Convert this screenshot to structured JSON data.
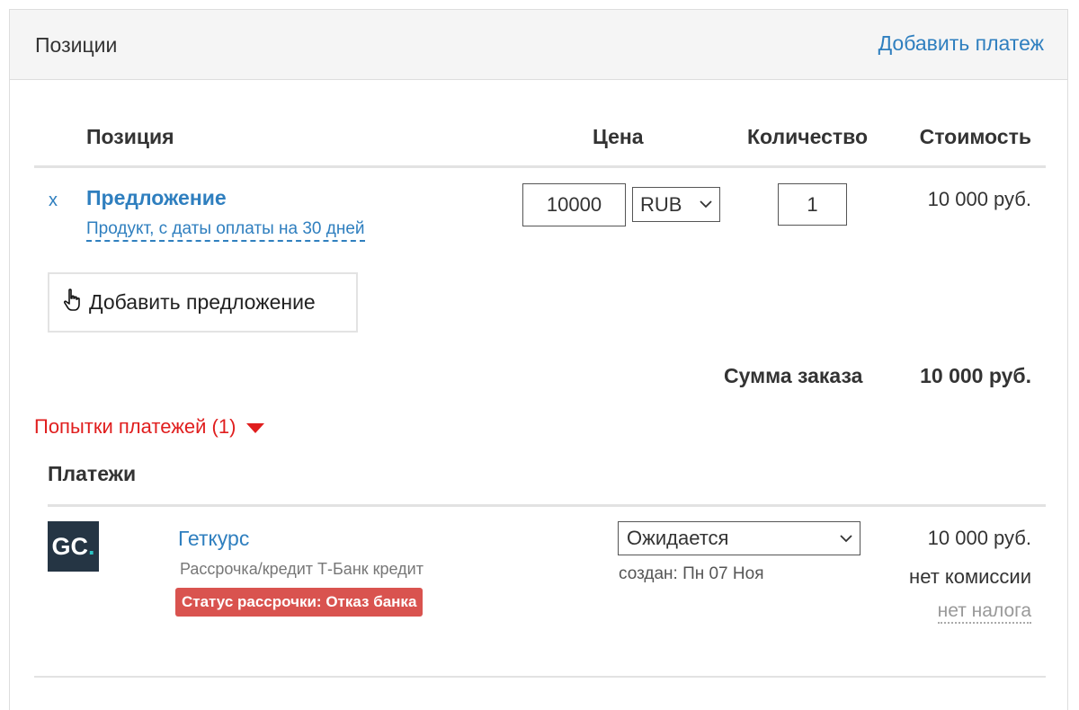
{
  "panel": {
    "title": "Позиции",
    "add_payment_link": "Добавить платеж"
  },
  "table_headers": {
    "position": "Позиция",
    "price": "Цена",
    "quantity": "Количество",
    "cost": "Стоимость"
  },
  "line_item": {
    "remove": "x",
    "name": "Предложение",
    "description": "Продукт, с даты оплаты на 30 дней",
    "price": "10000",
    "currency": "RUB",
    "quantity": "1",
    "cost": "10 000 руб."
  },
  "add_offer_button": "Добавить предложение",
  "order_total": {
    "label": "Сумма заказа",
    "value": "10 000 руб."
  },
  "payment_attempts": "Попытки платежей (1)",
  "payments": {
    "title": "Платежи",
    "items": [
      {
        "logo_text": "GC",
        "logo_dot": ".",
        "provider": "Геткурс",
        "method": "Рассрочка/кредит Т-Банк кредит",
        "badge": "Статус рассрочки: Отказ банка",
        "status": "Ожидается",
        "created": "создан: Пн 07 Ноя",
        "amount": "10 000 руб.",
        "commission": "нет комиссии",
        "tax": "нет налога"
      }
    ]
  },
  "colors": {
    "link": "#2f7fbf",
    "alert_red": "#e01e1e",
    "badge_red": "#d9534f",
    "logo_bg": "#253544",
    "logo_accent": "#2cc4c4"
  }
}
